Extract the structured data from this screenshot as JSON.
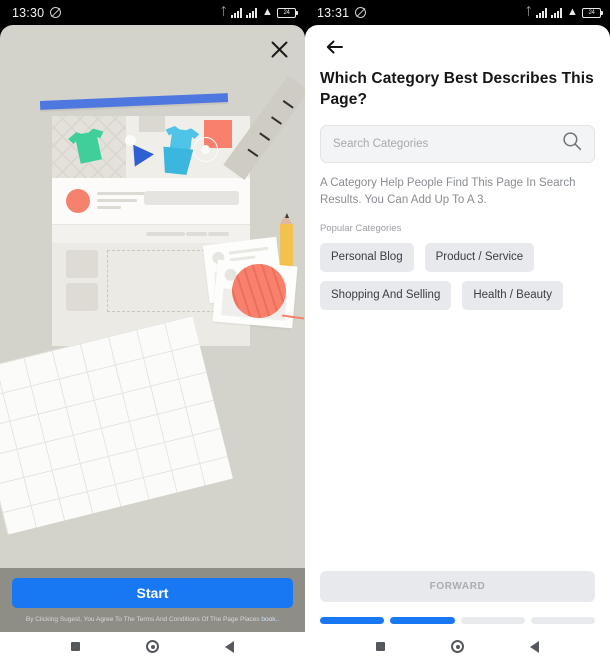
{
  "left_phone": {
    "status_bar": {
      "time": "13:30",
      "dnd_icon": "do-not-disturb-icon",
      "bluetooth_icon": "bluetooth-icon",
      "signal_icon_1": "signal-bars-icon",
      "signal_icon_2": "signal-bars-icon",
      "wifi_icon": "wifi-icon",
      "battery_icon": "battery-icon",
      "battery_level": "24"
    },
    "close_icon": "close-icon",
    "illustration": {
      "name": "page-creation-illustration",
      "elements": [
        "blue-bar",
        "page-mockup-card",
        "green-tshirt",
        "blue-tshirt",
        "play-button-triangle",
        "target-ring",
        "red-square",
        "ruler",
        "pencil",
        "photo-cards",
        "yarn-ball",
        "graph-paper-sheet"
      ]
    },
    "start_button_label": "Start",
    "legal_text": "By Clicking Sugest, You Agree To The Terms And Conditions Of The Page Places",
    "legal_link": "book..",
    "nav": {
      "recents_icon": "recents-square-icon",
      "home_icon": "home-circle-icon",
      "back_icon": "back-triangle-icon"
    }
  },
  "right_phone": {
    "status_bar": {
      "time": "13:31",
      "dnd_icon": "do-not-disturb-icon",
      "bluetooth_icon": "bluetooth-icon",
      "signal_icon_1": "signal-bars-icon",
      "signal_icon_2": "signal-bars-icon",
      "wifi_icon": "wifi-icon",
      "battery_icon": "battery-icon",
      "battery_level": "24"
    },
    "back_icon": "arrow-left-icon",
    "title": "Which Category Best Describes This Page?",
    "search": {
      "placeholder": "Search Categories",
      "value": "",
      "icon": "search-icon"
    },
    "description": "A Category Help People Find This Page In Search Results. You Can Add Up To A 3.",
    "popular_label": "Popular Categories",
    "chips": [
      {
        "label": "Personal Blog"
      },
      {
        "label": "Product / Service"
      },
      {
        "label": "Shopping And Selling"
      },
      {
        "label": "Health / Beauty"
      }
    ],
    "forward_button_label": "FORWARD",
    "progress": {
      "total": 4,
      "completed": 2,
      "segments": [
        "on",
        "on",
        "off",
        "off"
      ]
    },
    "nav": {
      "recents_icon": "recents-square-icon",
      "home_icon": "home-circle-icon",
      "back_icon": "back-triangle-icon"
    }
  },
  "colors": {
    "accent_blue": "#1877f2",
    "illustration_bg": "#d4d3cb",
    "left_footer_bg": "#8e8d86",
    "chip_bg": "#e7e9ec",
    "salmon": "#f8806c",
    "green": "#3fcf9b",
    "cyan": "#4fc3e8"
  }
}
